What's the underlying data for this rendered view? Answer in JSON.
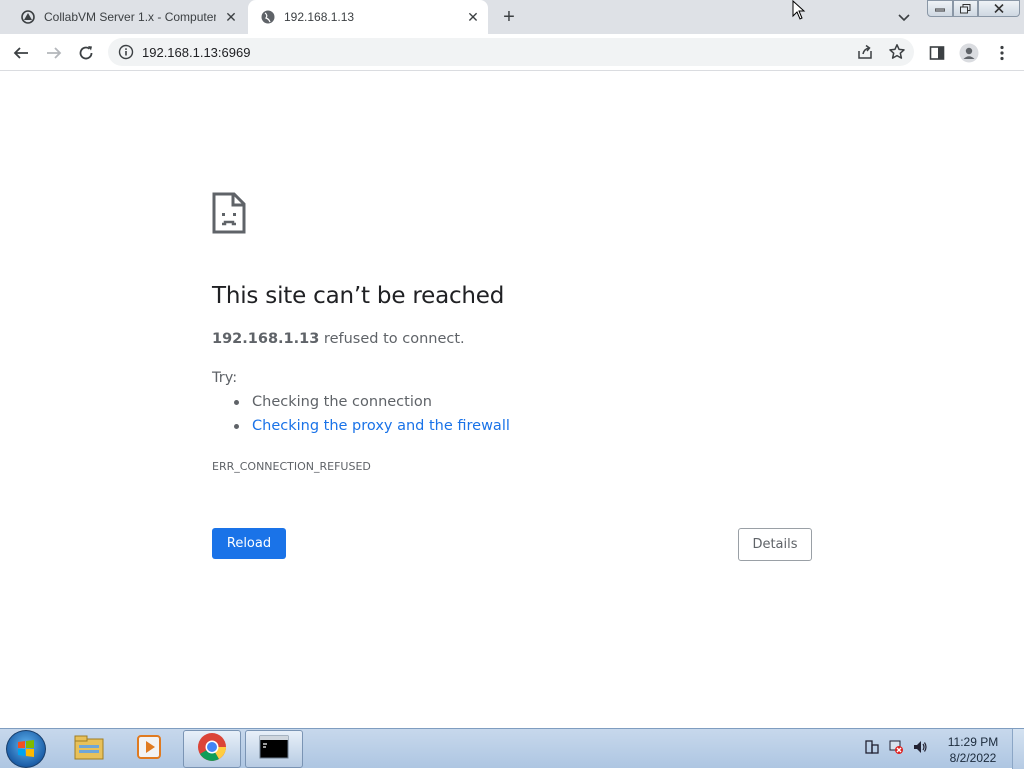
{
  "browser": {
    "tabs": [
      {
        "label": "CollabVM Server 1.x - Computer",
        "active": false
      },
      {
        "label": "192.168.1.13",
        "active": true
      }
    ],
    "address": "192.168.1.13:6969"
  },
  "error_page": {
    "heading": "This site can’t be reached",
    "host": "192.168.1.13",
    "message": " refused to connect.",
    "try_label": "Try:",
    "suggestions": [
      {
        "text": "Checking the connection",
        "link": false
      },
      {
        "text": "Checking the proxy and the firewall",
        "link": true
      }
    ],
    "error_code": "ERR_CONNECTION_REFUSED",
    "reload_label": "Reload",
    "details_label": "Details"
  },
  "taskbar": {
    "apps": [
      "explorer-icon",
      "media-player-icon",
      "chrome-icon",
      "cmd-icon"
    ],
    "time": "11:29 PM",
    "date": "8/2/2022"
  },
  "colors": {
    "accent": "#1a73e8",
    "text": "#202124",
    "muted": "#5f6368"
  }
}
